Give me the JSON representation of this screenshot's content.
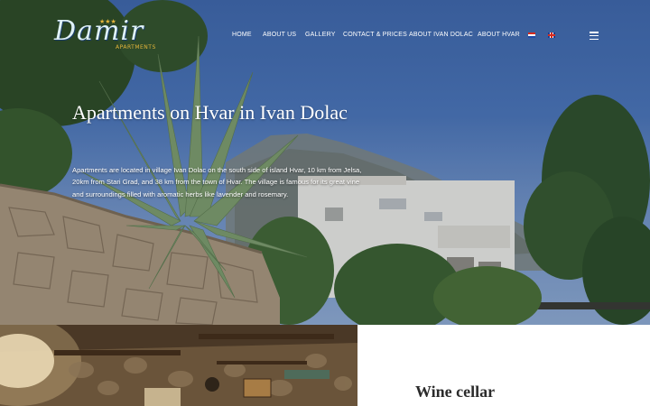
{
  "logo": {
    "script": "Damir",
    "stars": "★★★",
    "subtitle": "APARTMENTS"
  },
  "nav": {
    "items": [
      {
        "label": "HOME"
      },
      {
        "label": "ABOUT US"
      },
      {
        "label": "GALLERY"
      },
      {
        "label": "CONTACT & PRICES"
      },
      {
        "label": "ABOUT IVAN DOLAC"
      },
      {
        "label": "ABOUT HVAR"
      }
    ],
    "languages": [
      "hr",
      "en"
    ]
  },
  "hero": {
    "title": "Apartments on Hvar in Ivan Dolac",
    "text": "Apartments are located in village Ivan Dolac on the south side of island Hvar, 10 km from Jelsa, 20km from Stari Grad, and 38 km from the town of Hvar. The village is famous for its great vine and surroundings filled with aromatic herbs like lavender and rosemary."
  },
  "section": {
    "title": "Wine cellar"
  },
  "colors": {
    "sky": "#4a73b5",
    "gold": "#e3b43b",
    "text_dark": "#2b2b2b"
  }
}
